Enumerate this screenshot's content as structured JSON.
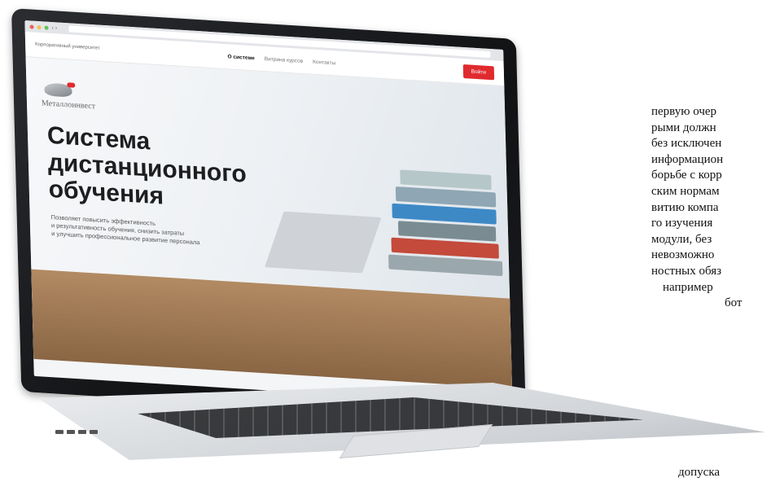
{
  "laptop_screen": {
    "browser": {
      "nav_buttons": "‹ ›",
      "address": ""
    },
    "site_header": {
      "logo_text": "Корпоративный университет",
      "nav": [
        "О системе",
        "Витрина курсов",
        "Контакты"
      ],
      "login_label": "Войти"
    },
    "hero": {
      "brand": "Металлоинвест",
      "title_lines": [
        "Система",
        "дистанционного",
        "обучения"
      ],
      "subtitle_lines": [
        "Позволяет повысить эффективность",
        "и результативность обучения, снизить затраты",
        "и улучшить профессиональное развитие персонала"
      ]
    }
  },
  "page_text": {
    "lines": [
      "первую очер",
      "рыми должн",
      "без исключен",
      "информацион",
      "борьбе с корр",
      "ским нормам",
      "витию компа",
      "го изучения",
      "модули, без",
      "невозможно",
      "ностных обяз",
      "например",
      "бот"
    ],
    "bottom_fragment": "допуска"
  },
  "colors": {
    "accent_red": "#e02a2e",
    "lid": "#111214"
  }
}
